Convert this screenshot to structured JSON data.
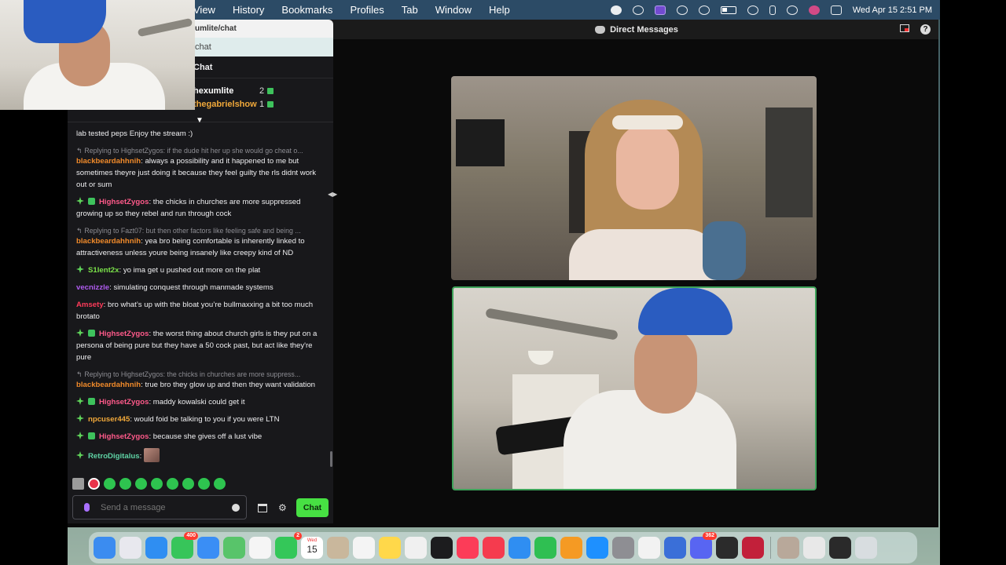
{
  "menubar": {
    "items": [
      "View",
      "History",
      "Bookmarks",
      "Profiles",
      "Tab",
      "Window",
      "Help"
    ],
    "clock": "Wed Apr 15  2:51 PM"
  },
  "window": {
    "title": "Direct Messages"
  },
  "chat_browser": {
    "url": "umlite/chat",
    "find_text": "chat",
    "header": "Chat",
    "leaderboard": [
      {
        "name": "hexumlite",
        "count": "2",
        "color": "#ffffff"
      },
      {
        "name": "thegabrielshow",
        "count": "1",
        "color": "#f0a83a"
      }
    ],
    "messages": [
      {
        "reply": "",
        "badges": [],
        "user": "",
        "color": "#efeff1",
        "text": "lab tested peps Enjoy the stream :)"
      },
      {
        "reply": "Replying to HighsetZygos: if the dude hit her up she would go cheat o...",
        "badges": [],
        "user": "blackbeardahhnih",
        "color": "#f08a2a",
        "text": "always a possibility and it happened to me but sometimes theyre just doing it because they feel guilty the rls didnt work out or sum"
      },
      {
        "reply": "",
        "badges": [
          "star",
          "gift"
        ],
        "user": "HighsetZygos",
        "color": "#ff5a8a",
        "text": "the chicks in churches are more suppressed growing up so they rebel and run through cock"
      },
      {
        "reply": "Replying to Fazt07: but then other factors like feeling safe and being ...",
        "badges": [],
        "user": "blackbeardahhnih",
        "color": "#f08a2a",
        "text": "yea bro being comfortable is inherently linked to attractiveness unless youre being insanely like creepy kind of ND"
      },
      {
        "reply": "",
        "badges": [
          "star"
        ],
        "user": "S1lent2x",
        "color": "#7be24a",
        "text": "yo ima get u pushed out more on the plat"
      },
      {
        "reply": "",
        "badges": [],
        "user": "vecnizzle",
        "color": "#b05cf0",
        "text": "simulating conquest through manmade systems"
      },
      {
        "reply": "",
        "badges": [],
        "user": "Amsety",
        "color": "#ff3b5a",
        "text": "bro what’s up with the bloat you’re bullmaxxing a bit too much brotato"
      },
      {
        "reply": "",
        "badges": [
          "star",
          "gift"
        ],
        "user": "HighsetZygos",
        "color": "#ff5a8a",
        "text": "the worst thing about church girls is they put on a persona of being pure but they have a 50 cock past, but act like they're pure"
      },
      {
        "reply": "Replying to HighsetZygos: the chicks in churches are more suppress...",
        "badges": [],
        "user": "blackbeardahhnih",
        "color": "#f08a2a",
        "text": "true bro they glow up and then they want validation"
      },
      {
        "reply": "",
        "badges": [
          "star",
          "gift"
        ],
        "user": "HighsetZygos",
        "color": "#ff5a8a",
        "text": "maddy kowalski could get it"
      },
      {
        "reply": "",
        "badges": [
          "star"
        ],
        "user": "npcuser445",
        "color": "#f0a83a",
        "text": "would foid be talking to you if you were LTN"
      },
      {
        "reply": "",
        "badges": [
          "star",
          "gift"
        ],
        "user": "HighsetZygos",
        "color": "#ff5a8a",
        "text": "because she gives off a lust vibe"
      },
      {
        "reply": "",
        "badges": [
          "star"
        ],
        "user": "RetroDigitalus",
        "color": "#5fd3a5",
        "text": "",
        "emote": true
      }
    ],
    "input_placeholder": "Send a message",
    "chat_button": "Chat"
  },
  "dock": {
    "apps": [
      {
        "name": "finder-icon",
        "color": "#3b8cf0"
      },
      {
        "name": "launchpad-icon",
        "color": "#e8e8ee"
      },
      {
        "name": "safari-icon",
        "color": "#2f8ef2"
      },
      {
        "name": "messages-icon",
        "color": "#37c55a",
        "badge": "400"
      },
      {
        "name": "mail-icon",
        "color": "#3a8ef5"
      },
      {
        "name": "maps-icon",
        "color": "#58c46a"
      },
      {
        "name": "photos-icon",
        "color": "#f5f5f5"
      },
      {
        "name": "facetime-icon",
        "color": "#34c759",
        "badge": "2"
      },
      {
        "name": "calendar-icon",
        "color": "#ffffff",
        "calendar_month": "Wed",
        "calendar_day": "15"
      },
      {
        "name": "contacts-icon",
        "color": "#c9b79c"
      },
      {
        "name": "reminders-icon",
        "color": "#f4f4f4"
      },
      {
        "name": "notes-icon",
        "color": "#ffd84a"
      },
      {
        "name": "freeform-icon",
        "color": "#f0f0f0"
      },
      {
        "name": "tv-icon",
        "color": "#1c1c1e"
      },
      {
        "name": "music-icon",
        "color": "#fc3c58"
      },
      {
        "name": "news-icon",
        "color": "#f53b4e"
      },
      {
        "name": "keynote-icon",
        "color": "#2f8ef2"
      },
      {
        "name": "numbers-icon",
        "color": "#2fbf52"
      },
      {
        "name": "pages-icon",
        "color": "#f59a23"
      },
      {
        "name": "appstore-icon",
        "color": "#1e90ff"
      },
      {
        "name": "settings-icon",
        "color": "#8e8e93"
      },
      {
        "name": "chrome-icon",
        "color": "#f2f2f2"
      },
      {
        "name": "simulator-icon",
        "color": "#3a6fd8"
      },
      {
        "name": "discord-icon",
        "color": "#5865f2",
        "badge": "362"
      },
      {
        "name": "obs-icon",
        "color": "#2b2b2b"
      },
      {
        "name": "dictionary-icon",
        "color": "#c2203a"
      }
    ],
    "stack_items": [
      {
        "name": "folder-thumb-1",
        "color": "#b8a89a"
      },
      {
        "name": "folder-thumb-2",
        "color": "#e8e8e8"
      },
      {
        "name": "folder-thumb-3",
        "color": "#2a2a2a"
      },
      {
        "name": "trash-icon",
        "color": "#d8dde0"
      }
    ]
  }
}
